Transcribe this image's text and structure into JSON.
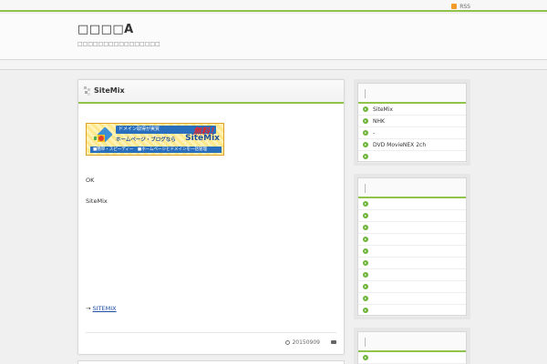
{
  "topbar": {
    "rss_label": "RSS"
  },
  "header": {
    "title": "□□□□A",
    "description": "□□□□□□□□□□□□□□□□"
  },
  "post": {
    "title": "SiteMix",
    "banner": {
      "top_text": "ドメイン取得が実質",
      "free_text": "無料！",
      "mid_text": "ホームページ・ブログなら",
      "brand_text": "SiteMix",
      "bottom_text": "■簡単・スピーディー　■ホームページとドメインを一括管理"
    },
    "text1": "OK",
    "text2": "SiteMix",
    "link_prefix": "→",
    "link_text": "SITEMIX",
    "date": "20150909"
  },
  "sidebar": {
    "widget1": {
      "items": [
        "SiteMix",
        "NHK",
        "-",
        "DVD MovieNEX 2ch",
        ""
      ]
    },
    "widget2": {
      "items": [
        "",
        "",
        "",
        "",
        "",
        "",
        "",
        "",
        "",
        "",
        ""
      ]
    },
    "widget3": {
      "items": [
        ""
      ]
    }
  },
  "colors": {
    "accent": "#8fc34a",
    "bullet": "#6fb53a",
    "link": "#1d4fa7"
  }
}
